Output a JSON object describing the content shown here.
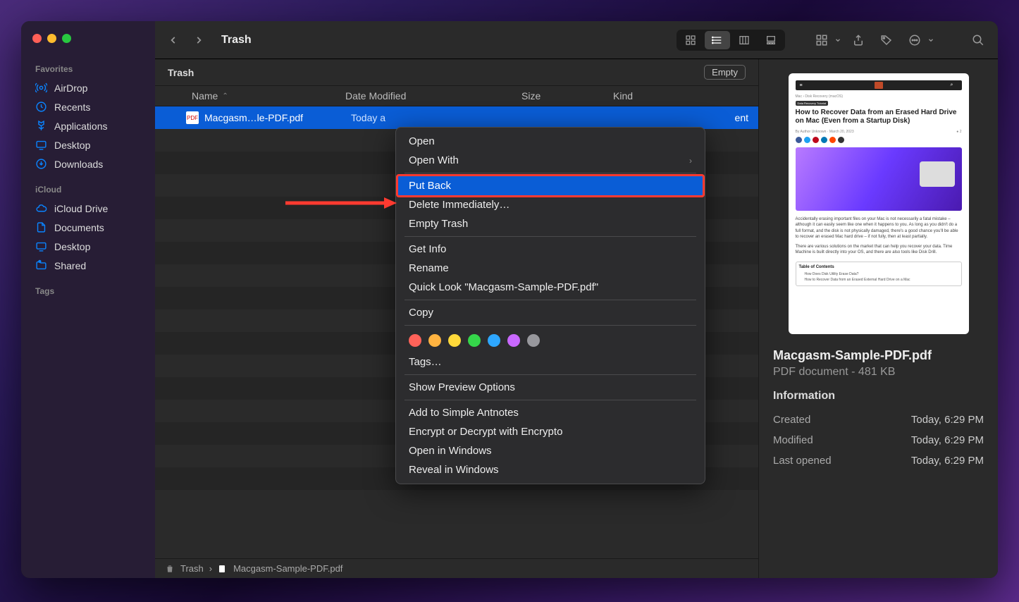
{
  "window": {
    "title": "Trash",
    "location_label": "Trash",
    "empty_button": "Empty"
  },
  "sidebar": {
    "sections": [
      {
        "header": "Favorites",
        "items": [
          {
            "label": "AirDrop",
            "icon": "airdrop"
          },
          {
            "label": "Recents",
            "icon": "clock"
          },
          {
            "label": "Applications",
            "icon": "apps"
          },
          {
            "label": "Desktop",
            "icon": "desktop"
          },
          {
            "label": "Downloads",
            "icon": "download"
          }
        ]
      },
      {
        "header": "iCloud",
        "items": [
          {
            "label": "iCloud Drive",
            "icon": "cloud"
          },
          {
            "label": "Documents",
            "icon": "doc"
          },
          {
            "label": "Desktop",
            "icon": "desktop"
          },
          {
            "label": "Shared",
            "icon": "shared"
          }
        ]
      },
      {
        "header": "Tags",
        "items": []
      }
    ]
  },
  "columns": {
    "name": "Name",
    "date": "Date Modified",
    "size": "Size",
    "kind": "Kind"
  },
  "files": [
    {
      "name": "Macgasm…le-PDF.pdf",
      "date_modified": "Today a",
      "kind_partial": "ent"
    }
  ],
  "pathbar": {
    "items": [
      "Trash",
      "Macgasm-Sample-PDF.pdf"
    ]
  },
  "context_menu": {
    "open": "Open",
    "open_with": "Open With",
    "put_back": "Put Back",
    "delete_immediately": "Delete Immediately…",
    "empty_trash": "Empty Trash",
    "get_info": "Get Info",
    "rename": "Rename",
    "quick_look": "Quick Look \"Macgasm-Sample-PDF.pdf\"",
    "copy": "Copy",
    "tags": "Tags…",
    "show_preview": "Show Preview Options",
    "add_to_antnotes": "Add to Simple Antnotes",
    "encrypt": "Encrypt or Decrypt with Encrypto",
    "open_in_windows": "Open in Windows",
    "reveal_in_windows": "Reveal in Windows",
    "tag_colors": [
      "#ff6259",
      "#ffb340",
      "#ffd93a",
      "#35d64a",
      "#2ea7ff",
      "#c968ff",
      "#98989d"
    ]
  },
  "preview": {
    "filename": "Macgasm-Sample-PDF.pdf",
    "subtitle": "PDF document - 481 KB",
    "info_header": "Information",
    "rows": [
      {
        "label": "Created",
        "value": "Today, 6:29 PM"
      },
      {
        "label": "Modified",
        "value": "Today, 6:29 PM"
      },
      {
        "label": "Last opened",
        "value": "Today, 6:29 PM"
      }
    ],
    "thumb": {
      "crumb": "Mac › Disk Recovery (macOS)",
      "badge": "Data Recovery Tutorial",
      "title": "How to Recover Data from an Erased Hard Drive on Mac (Even from a Startup Disk)",
      "meta_author": "By Author Unknown · March 20, 2023",
      "meta_right": "● 2",
      "para1": "Accidentally erasing important files on your Mac is not necessarily a fatal mistake – although it can easily seem like one when it happens to you. As long as you didn't do a full format, and the disk is not physically damaged, there's a good chance you'll be able to recover an erased Mac hard drive – if not fully, then at least partially.",
      "para2": "There are various solutions on the market that can help you recover your data. Time Machine is built directly into your OS, and there are also tools like Disk Drill.",
      "toc_header": "Table of Contents",
      "toc1": "How Does Disk Utility Erase Data?",
      "toc2": "How to Recover Data from an Erased External Hard Drive on a Mac"
    }
  }
}
